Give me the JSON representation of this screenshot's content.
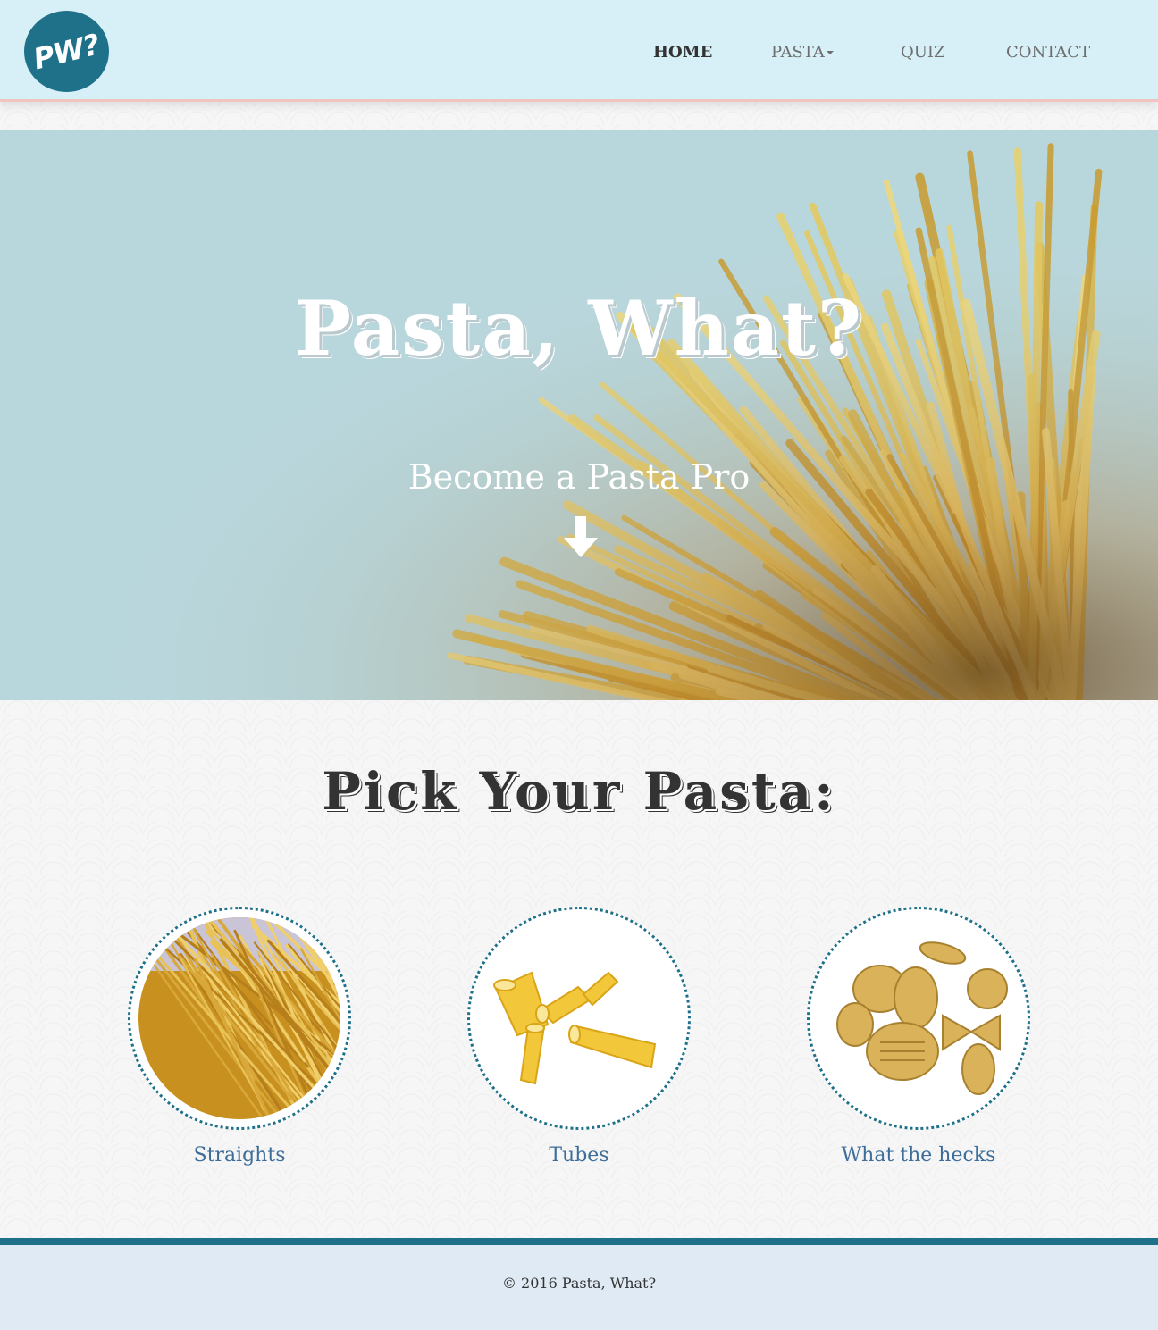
{
  "brand": {
    "logo_text": "PW?"
  },
  "nav": {
    "items": [
      {
        "label": "HOME",
        "active": true
      },
      {
        "label": "PASTA",
        "dropdown": true
      },
      {
        "label": "QUIZ"
      },
      {
        "label": "CONTACT"
      }
    ]
  },
  "hero": {
    "title": "Pasta, What?",
    "subtitle": "Become a Pasta Pro",
    "arrow_icon": "arrow-down-icon"
  },
  "pick": {
    "title": "Pick Your Pasta:",
    "cards": [
      {
        "label": "Straights",
        "image": "spaghetti-image"
      },
      {
        "label": "Tubes",
        "image": "penne-image"
      },
      {
        "label": "What the hecks",
        "image": "mixed-pasta-image"
      }
    ]
  },
  "footer": {
    "text": "© 2016 Pasta, What?"
  },
  "colors": {
    "nav_bg": "#d7f0f8",
    "accent": "#1f718a",
    "hero_bg": "#b8d7dd",
    "card_label": "#3d6e9a",
    "footer_bg": "#dfeaf4"
  }
}
